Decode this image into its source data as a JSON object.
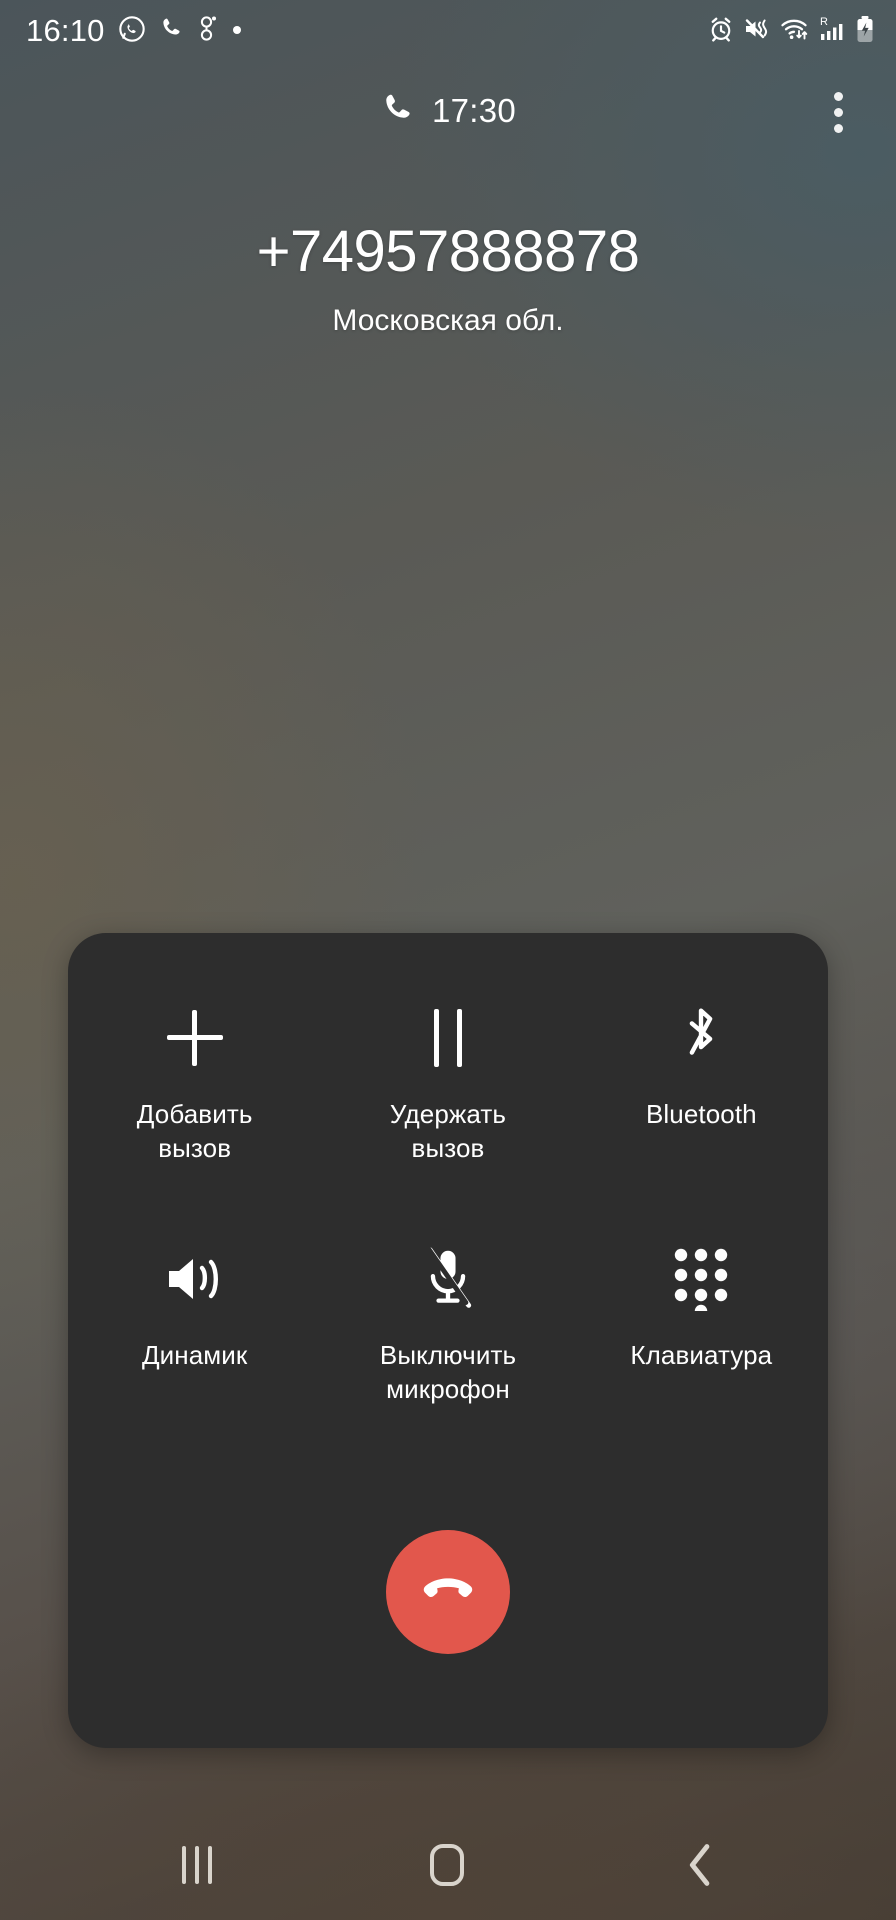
{
  "statusbar": {
    "clock": "16:10",
    "left_icons": [
      {
        "name": "whatsapp-icon"
      },
      {
        "name": "phone-call-icon"
      },
      {
        "name": "google-voice-icon"
      },
      {
        "name": "more-notifications-dot-icon"
      }
    ],
    "right_icons": [
      {
        "name": "alarm-icon"
      },
      {
        "name": "vibrate-mute-icon"
      },
      {
        "name": "wifi-data-transfer-icon"
      },
      {
        "name": "signal-roaming-icon",
        "label": "R"
      },
      {
        "name": "battery-charging-icon"
      }
    ]
  },
  "call": {
    "duration": "17:30",
    "duration_icon": "phone-handset-icon",
    "overflow_menu": "more-options-icon",
    "number": "+74957888878",
    "location": "Московская обл."
  },
  "options": {
    "row1": [
      {
        "id": "add-call",
        "icon": "plus-icon",
        "label": "Добавить\nвызов"
      },
      {
        "id": "hold-call",
        "icon": "pause-icon",
        "label": "Удержать\nвызов"
      },
      {
        "id": "bluetooth",
        "icon": "bluetooth-icon",
        "label": "Bluetooth"
      }
    ],
    "row2": [
      {
        "id": "speaker",
        "icon": "speaker-icon",
        "label": "Динамик"
      },
      {
        "id": "mute-mic",
        "icon": "microphone-off-icon",
        "label": "Выключить\nмикрофон"
      },
      {
        "id": "keypad",
        "icon": "dialpad-icon",
        "label": "Клавиатура"
      }
    ]
  },
  "end_call": {
    "icon": "hang-up-icon",
    "color": "#e2574c"
  },
  "navbar": {
    "recents": "recents-icon",
    "home": "home-icon",
    "back": "back-icon"
  },
  "colors": {
    "panel": "#2d2d2d",
    "end_call": "#e2574c",
    "text": "#ffffff",
    "nav_icon": "#d9d4cc"
  }
}
